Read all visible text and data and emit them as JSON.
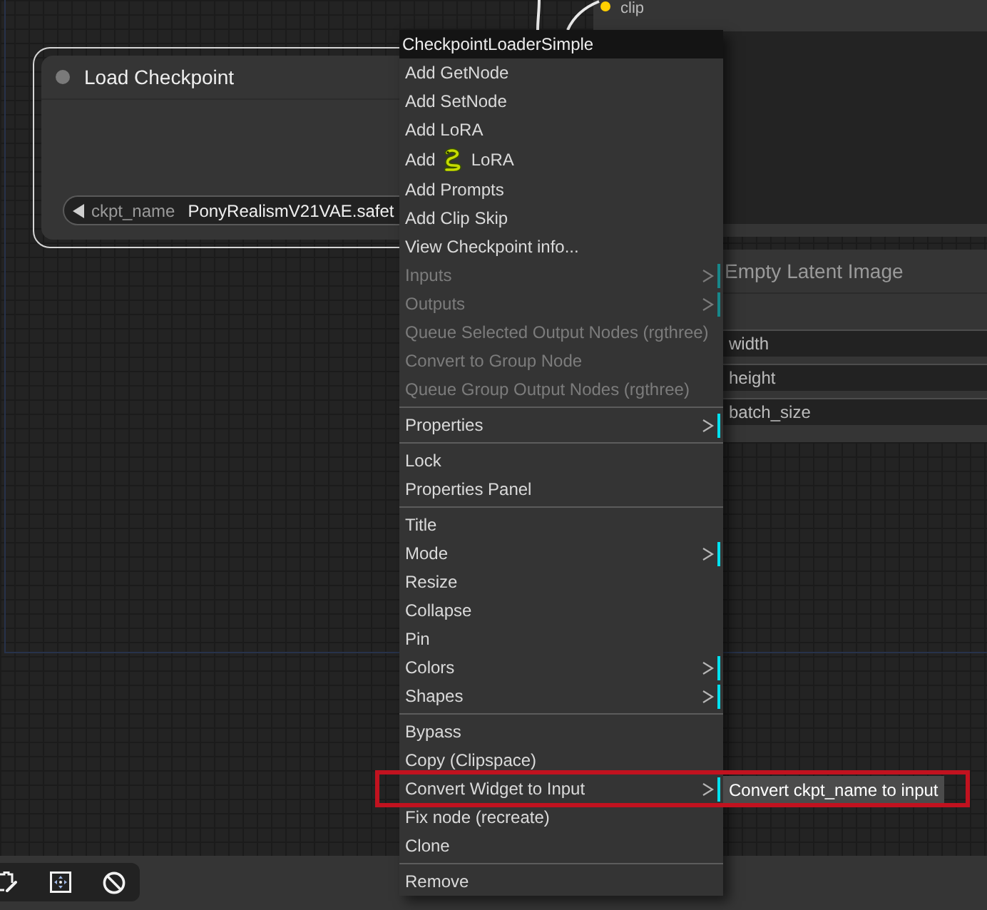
{
  "canvas": {
    "nodes": [
      {
        "kind": "loader",
        "title": "Load Checkpoint",
        "selected": true,
        "widget": {
          "label": "ckpt_name",
          "value": "PonyRealismV21VAE.safet"
        }
      },
      {
        "kind": "text_encoder",
        "selected": false,
        "input": "clip"
      },
      {
        "kind": "latent",
        "title": "Empty Latent Image",
        "selected": false,
        "widgets": [
          "width",
          "height",
          "batch_size"
        ]
      }
    ]
  },
  "context_menu": {
    "title": "CheckpointLoaderSimple",
    "items": [
      {
        "kind": "item",
        "label": "Add GetNode",
        "disabled": false,
        "submenu": false
      },
      {
        "kind": "item",
        "label": "Add SetNode",
        "disabled": false,
        "submenu": false
      },
      {
        "kind": "item",
        "label": "Add LoRA",
        "disabled": false,
        "submenu": false
      },
      {
        "kind": "icon_item",
        "label": "Add",
        "label_after": "LoRA",
        "disabled": false,
        "submenu": false
      },
      {
        "kind": "item",
        "label": "Add Prompts",
        "disabled": false,
        "submenu": false
      },
      {
        "kind": "item",
        "label": "Add Clip Skip",
        "disabled": false,
        "submenu": false
      },
      {
        "kind": "item",
        "label": "View Checkpoint info...",
        "disabled": false,
        "submenu": false
      },
      {
        "kind": "item",
        "label": "Inputs",
        "disabled": true,
        "submenu": true
      },
      {
        "kind": "item",
        "label": "Outputs",
        "disabled": true,
        "submenu": true
      },
      {
        "kind": "item",
        "label": "Queue Selected Output Nodes (rgthree)",
        "disabled": true,
        "submenu": false
      },
      {
        "kind": "item",
        "label": "Convert to Group Node",
        "disabled": true,
        "submenu": false
      },
      {
        "kind": "item",
        "label": "Queue Group Output Nodes (rgthree)",
        "disabled": true,
        "submenu": false
      },
      {
        "kind": "separator"
      },
      {
        "kind": "item",
        "label": "Properties",
        "disabled": false,
        "submenu": true
      },
      {
        "kind": "separator"
      },
      {
        "kind": "item",
        "label": "Lock",
        "disabled": false,
        "submenu": false
      },
      {
        "kind": "item",
        "label": "Properties Panel",
        "disabled": false,
        "submenu": false
      },
      {
        "kind": "separator"
      },
      {
        "kind": "item",
        "label": "Title",
        "disabled": false,
        "submenu": false
      },
      {
        "kind": "item",
        "label": "Mode",
        "disabled": false,
        "submenu": true
      },
      {
        "kind": "item",
        "label": "Resize",
        "disabled": false,
        "submenu": false
      },
      {
        "kind": "item",
        "label": "Collapse",
        "disabled": false,
        "submenu": false
      },
      {
        "kind": "item",
        "label": "Pin",
        "disabled": false,
        "submenu": false
      },
      {
        "kind": "item",
        "label": "Colors",
        "disabled": false,
        "submenu": true
      },
      {
        "kind": "item",
        "label": "Shapes",
        "disabled": false,
        "submenu": true
      },
      {
        "kind": "separator"
      },
      {
        "kind": "item",
        "label": "Bypass",
        "disabled": false,
        "submenu": false
      },
      {
        "kind": "item",
        "label": "Copy (Clipspace)",
        "disabled": false,
        "submenu": false
      },
      {
        "kind": "item",
        "label": "Convert Widget to Input",
        "disabled": false,
        "submenu": true,
        "submenu_items": [
          {
            "label": "Convert ckpt_name to input"
          }
        ]
      },
      {
        "kind": "item",
        "label": "Fix node (recreate)",
        "disabled": false,
        "submenu": false
      },
      {
        "kind": "item",
        "label": "Clone",
        "disabled": false,
        "submenu": false
      },
      {
        "kind": "separator"
      },
      {
        "kind": "item",
        "label": "Remove",
        "disabled": false,
        "submenu": false
      }
    ]
  }
}
